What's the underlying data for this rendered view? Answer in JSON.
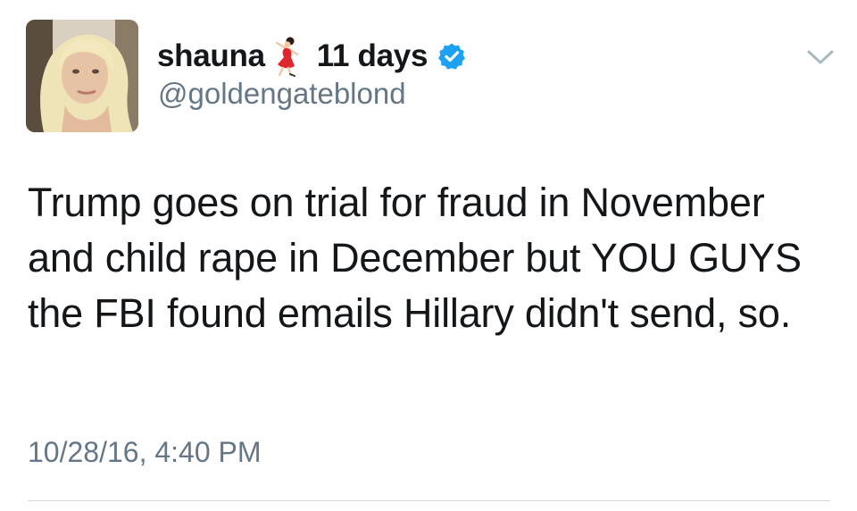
{
  "tweet": {
    "author": {
      "display_name": "shauna",
      "handle": "@goldengateblond",
      "name_emoji": "dancer-emoji",
      "verified": true,
      "avatar": "profile-photo"
    },
    "relative_time": "11 days",
    "text": "Trump goes on trial for fraud in November and child rape in December but YOU GUYS the FBI found emails Hillary didn't send, so.",
    "date": "10/28/16, 4:40 PM"
  },
  "icons": {
    "verified_badge": "verified-badge-icon",
    "menu": "chevron-down-icon"
  },
  "colors": {
    "text": "#14171a",
    "secondary_text": "#657786",
    "verified_blue": "#1da1f2",
    "divider": "#d4d8db",
    "background": "#ffffff"
  }
}
